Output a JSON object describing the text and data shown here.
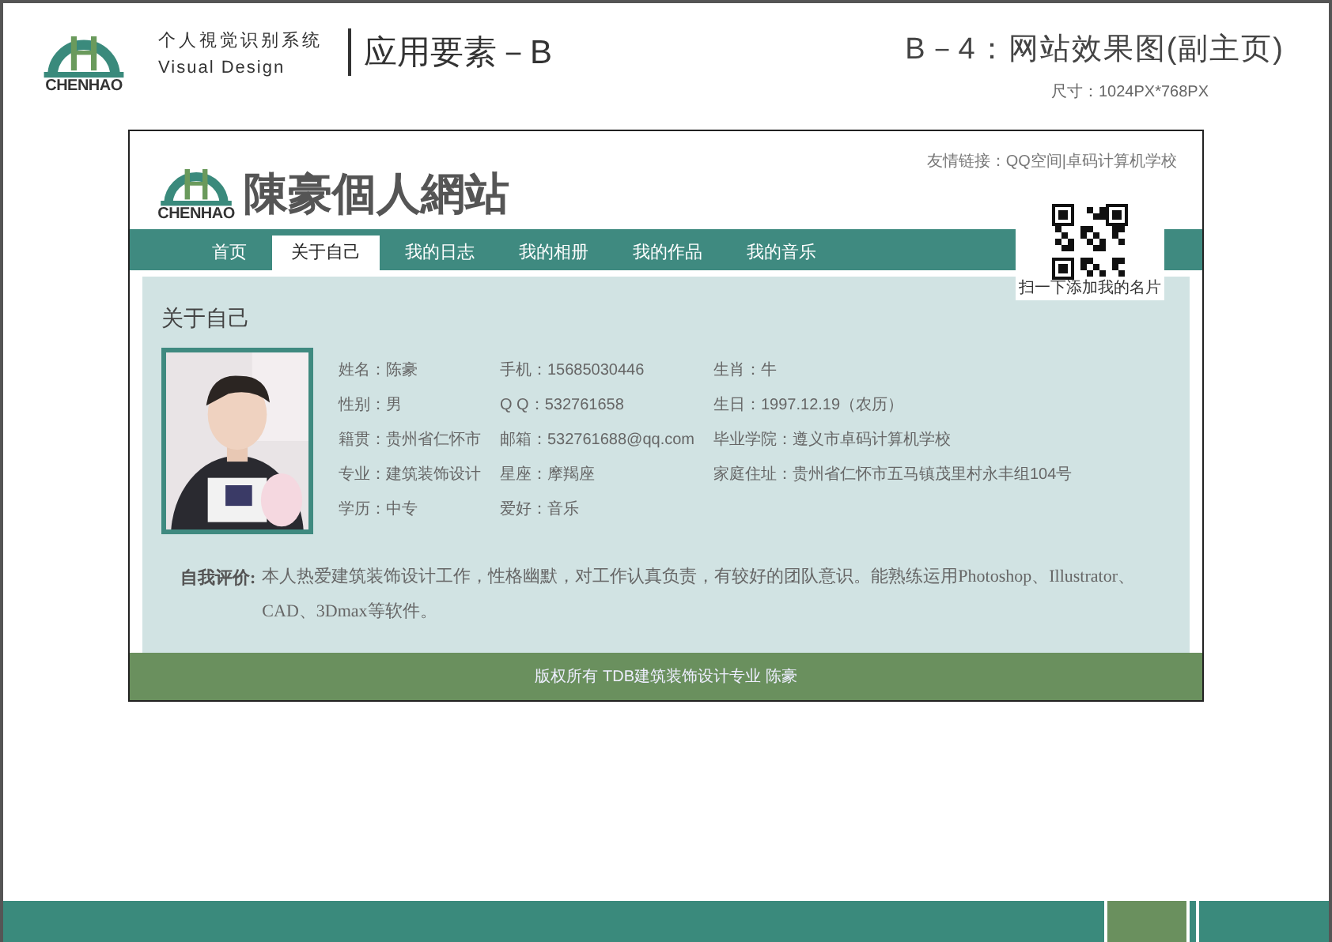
{
  "header": {
    "logo_text": "CHENHAO",
    "system_name": "个人視觉识别系统",
    "system_subtitle": "Visual Design",
    "section": "应用要素－B",
    "page_title": "B－4：网站效果图(副主页)",
    "size_note": "尺寸：1024PX*768PX"
  },
  "site": {
    "logo_text": "CHENHAO",
    "title": "陳豪個人網站",
    "friend_links": "友情链接：QQ空间|卓码计算机学校",
    "nav": [
      {
        "label": "首页",
        "selected": false
      },
      {
        "label": "关于自己",
        "selected": true
      },
      {
        "label": "我的日志",
        "selected": false
      },
      {
        "label": "我的相册",
        "selected": false
      },
      {
        "label": "我的作品",
        "selected": false
      },
      {
        "label": "我的音乐",
        "selected": false
      }
    ],
    "qr_caption": "扫一下添加我的名片",
    "heading": "关于自己",
    "photo": {
      "kind": "picture"
    },
    "info_columns": [
      [
        "姓名：陈豪",
        "性别：男",
        "籍贯：贵州省仁怀市",
        "专业：建筑装饰设计",
        "学历：中专"
      ],
      [
        "手机：15685030446",
        "Q  Q：532761658",
        "邮箱：532761688@qq.com",
        "星座：摩羯座",
        "爱好：音乐"
      ],
      [
        "生肖：牛",
        "生日：1997.12.19（农历）",
        "毕业学院：遵义市卓码计算机学校",
        "家庭住址：贵州省仁怀市五马镇茂里村永丰组104号"
      ]
    ],
    "self_review": {
      "label": "自我评价:",
      "text": "本人热爱建筑装饰设计工作，性格幽默，对工作认真负责，有较好的团队意识。能熟练运用Photoshop、Illustrator、CAD、3Dmax等软件。"
    },
    "footer": "版权所有 TDB建筑装饰设计专业 陈豪"
  }
}
